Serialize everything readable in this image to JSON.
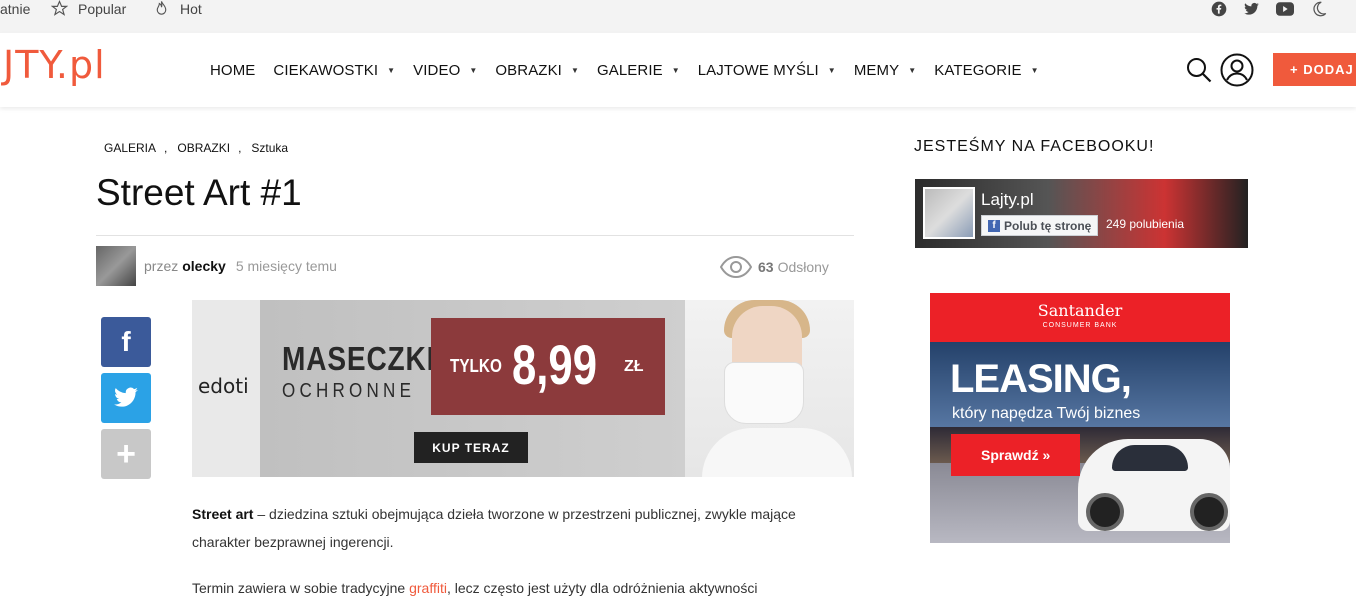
{
  "topbar": {
    "items": [
      {
        "label": "atnie",
        "icon": "none"
      },
      {
        "label": "Popular",
        "icon": "star-icon"
      },
      {
        "label": "Hot",
        "icon": "flame-icon"
      }
    ],
    "social": [
      "facebook-icon",
      "twitter-icon",
      "youtube-icon",
      "moon-icon"
    ]
  },
  "header": {
    "logo": "JTY.pl",
    "nav": [
      {
        "label": "HOME",
        "has_caret": false
      },
      {
        "label": "CIEKAWOSTKI",
        "has_caret": true
      },
      {
        "label": "VIDEO",
        "has_caret": true
      },
      {
        "label": "OBRAZKI",
        "has_caret": true
      },
      {
        "label": "GALERIE",
        "has_caret": true
      },
      {
        "label": "LAJTOWE MYŚLI",
        "has_caret": true
      },
      {
        "label": "MEMY",
        "has_caret": true
      },
      {
        "label": "KATEGORIE",
        "has_caret": true
      }
    ],
    "add_button": "+ DODAJ",
    "accent": "#f05a3c"
  },
  "article": {
    "categories": [
      "GALERIA",
      "OBRAZKI",
      "Sztuka"
    ],
    "separator": ",",
    "title": "Street Art #1",
    "by": "przez",
    "author": "olecky",
    "time": "5 miesięcy temu",
    "views_count": "63",
    "views_label": "Odsłony",
    "share": {
      "facebook": "f",
      "twitter": "t",
      "more": "+"
    },
    "ad": {
      "brand": "edoti",
      "line1": "MASECZKI",
      "line2": "OCHRONNE",
      "only": "TYLKO",
      "price": "8,99",
      "currency": "ZŁ",
      "cta": "KUP TERAZ"
    },
    "p1_bold": "Street art",
    "p1_rest": " – dziedzina sztuki obejmująca dzieła tworzone w przestrzeni publicznej, zwykle mające charakter bezprawnej ingerencji.",
    "p2_start": "Termin zawiera w sobie tradycyjne ",
    "p2_link": "graffiti",
    "p2_end": ", lecz często jest użyty dla odróżnienia aktywności"
  },
  "sidebar": {
    "fb_title": "JESTEŚMY NA FACEBOOKU!",
    "fb_page_name": "Lajty.pl",
    "fb_like": "Polub tę stronę",
    "fb_likes": "249 polubienia",
    "ad": {
      "bank": "Santander",
      "bank_sub": "CONSUMER BANK",
      "headline": "LEASING,",
      "tagline": "który napędza Twój biznes",
      "cta": "Sprawdź  »"
    }
  }
}
